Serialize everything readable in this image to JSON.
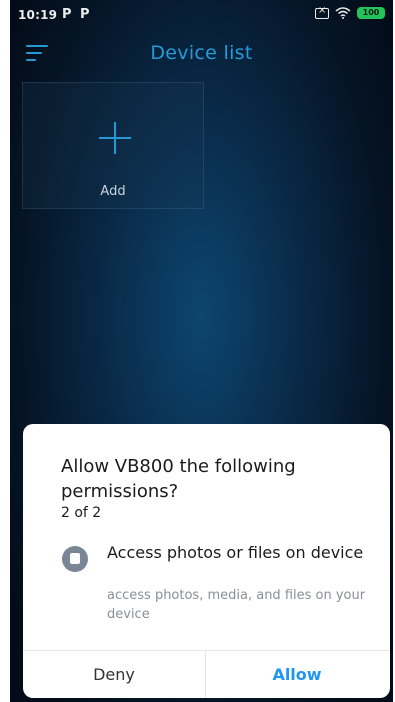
{
  "status_bar": {
    "time": "10:19",
    "notification_1": "P",
    "notification_2": "P",
    "battery_level": "100"
  },
  "app_bar": {
    "title": "Device list",
    "menu_icon": "hamburger-icon"
  },
  "device_tile": {
    "label": "Add",
    "icon": "plus-icon"
  },
  "permission_dialog": {
    "title": "Allow VB800 the following permissions?",
    "count": "2 of 2",
    "permission_title": "Access photos or files on device",
    "permission_description": "access photos, media, and files on your device",
    "deny_label": "Deny",
    "allow_label": "Allow"
  },
  "colors": {
    "accent": "#29a9ec",
    "allow_button": "#2196f3",
    "battery": "#25d463"
  }
}
